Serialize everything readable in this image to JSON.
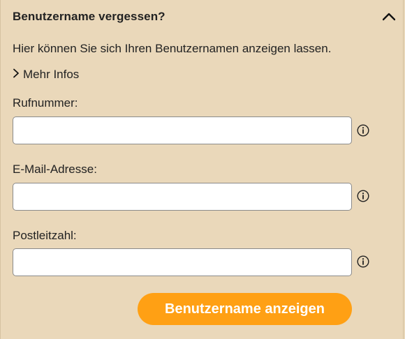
{
  "accordion": {
    "title": "Benutzername vergessen?",
    "expanded": true,
    "description": "Hier können Sie sich Ihren Benutzernamen anzeigen lassen.",
    "more_info_label": "Mehr Infos"
  },
  "form": {
    "fields": [
      {
        "label": "Rufnummer:",
        "value": "",
        "placeholder": ""
      },
      {
        "label": "E-Mail-Adresse:",
        "value": "",
        "placeholder": ""
      },
      {
        "label": "Postleitzahl:",
        "value": "",
        "placeholder": ""
      }
    ],
    "submit_label": "Benutzername anzeigen"
  },
  "colors": {
    "background": "#ead8ba",
    "button": "#ffa014",
    "button_text": "#ffffff"
  },
  "icons": {
    "collapse": "chevron-up-icon",
    "more_info": "chevron-right-icon",
    "field_info": "info-icon"
  }
}
